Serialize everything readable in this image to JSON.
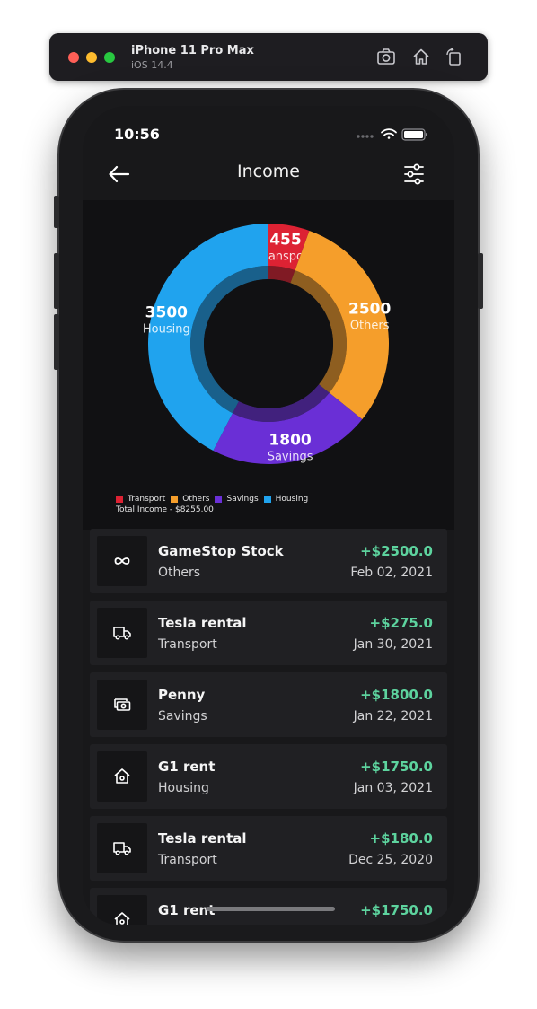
{
  "simulator": {
    "device": "iPhone 11 Pro Max",
    "os": "iOS 14.4",
    "icons": [
      "screenshot-icon",
      "home-icon",
      "rotate-icon"
    ]
  },
  "status_bar": {
    "time": "10:56",
    "icons": [
      "signal-dots-icon",
      "wifi-icon",
      "battery-icon"
    ]
  },
  "nav": {
    "title": "Income",
    "back_icon": "arrow-left-icon",
    "filter_icon": "sliders-icon"
  },
  "colors": {
    "transport": "#dd2233",
    "others": "#f59e2b",
    "savings": "#6a2fd6",
    "housing": "#20a3ee",
    "income_positive": "#5dd39e"
  },
  "chart_data": {
    "type": "pie",
    "categories": [
      "Transport",
      "Others",
      "Savings",
      "Housing"
    ],
    "values": [
      455,
      2500,
      1800,
      3500
    ],
    "labels": [
      "455",
      "2500",
      "1800",
      "3500"
    ],
    "legend": [
      "Transport",
      "Others",
      "Savings",
      "Housing"
    ],
    "total_label": "Total Income - $8255.00"
  },
  "transactions": [
    {
      "name": "GameStop Stock",
      "category": "Others",
      "amount": "+$2500.0",
      "date": "Feb 02, 2021",
      "icon": "infinity-icon"
    },
    {
      "name": "Tesla rental",
      "category": "Transport",
      "amount": "+$275.0",
      "date": "Jan 30, 2021",
      "icon": "truck-icon"
    },
    {
      "name": "Penny",
      "category": "Savings",
      "amount": "+$1800.0",
      "date": "Jan 22, 2021",
      "icon": "cash-icon"
    },
    {
      "name": "G1 rent",
      "category": "Housing",
      "amount": "+$1750.0",
      "date": "Jan 03, 2021",
      "icon": "house-icon"
    },
    {
      "name": "Tesla rental",
      "category": "Transport",
      "amount": "+$180.0",
      "date": "Dec 25, 2020",
      "icon": "truck-icon"
    },
    {
      "name": "G1 rent",
      "category": "",
      "amount": "+$1750.0",
      "date": "",
      "icon": "house-icon"
    }
  ]
}
